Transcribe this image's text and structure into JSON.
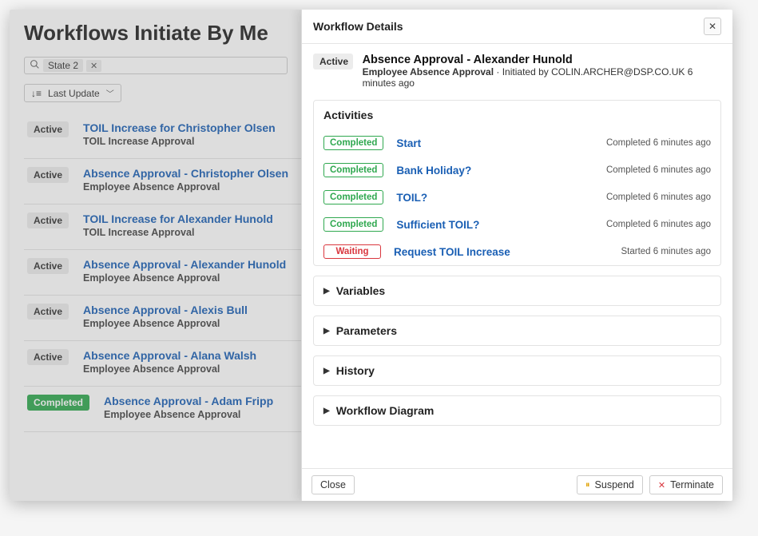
{
  "page": {
    "title": "Workflows Initiate By Me",
    "filter_chip": "State 2",
    "sort_label": "Last Update"
  },
  "workflows": [
    {
      "status": "Active",
      "status_class": "active",
      "title": "TOIL Increase for Christopher Olsen",
      "sub": "TOIL Increase Approval"
    },
    {
      "status": "Active",
      "status_class": "active",
      "title": "Absence Approval - Christopher Olsen",
      "sub": "Employee Absence Approval"
    },
    {
      "status": "Active",
      "status_class": "active",
      "title": "TOIL Increase for Alexander Hunold",
      "sub": "TOIL Increase Approval"
    },
    {
      "status": "Active",
      "status_class": "active",
      "title": "Absence Approval - Alexander Hunold",
      "sub": "Employee Absence Approval"
    },
    {
      "status": "Active",
      "status_class": "active",
      "title": "Absence Approval - Alexis Bull",
      "sub": "Employee Absence Approval"
    },
    {
      "status": "Active",
      "status_class": "active",
      "title": "Absence Approval - Alana Walsh",
      "sub": "Employee Absence Approval"
    },
    {
      "status": "Completed",
      "status_class": "completed-green",
      "title": "Absence Approval - Adam Fripp",
      "sub": "Employee Absence Approval"
    }
  ],
  "drawer": {
    "header": "Workflow Details",
    "status": "Active",
    "title": "Absence Approval - Alexander Hunold",
    "subtitle_bold": "Employee Absence Approval",
    "subtitle_rest": " · Initiated by COLIN.ARCHER@DSP.CO.UK 6 minutes ago",
    "sections": {
      "activities": "Activities",
      "variables": "Variables",
      "parameters": "Parameters",
      "history": "History",
      "diagram": "Workflow Diagram"
    },
    "activities": [
      {
        "status": "Completed",
        "status_class": "completed",
        "name": "Start",
        "time": "Completed 6 minutes ago"
      },
      {
        "status": "Completed",
        "status_class": "completed",
        "name": "Bank Holiday?",
        "time": "Completed 6 minutes ago"
      },
      {
        "status": "Completed",
        "status_class": "completed",
        "name": "TOIL?",
        "time": "Completed 6 minutes ago"
      },
      {
        "status": "Completed",
        "status_class": "completed",
        "name": "Sufficient TOIL?",
        "time": "Completed 6 minutes ago"
      },
      {
        "status": "Waiting",
        "status_class": "waiting",
        "name": "Request TOIL Increase",
        "time": "Started 6 minutes ago"
      }
    ],
    "footer": {
      "close": "Close",
      "suspend": "Suspend",
      "terminate": "Terminate"
    }
  }
}
